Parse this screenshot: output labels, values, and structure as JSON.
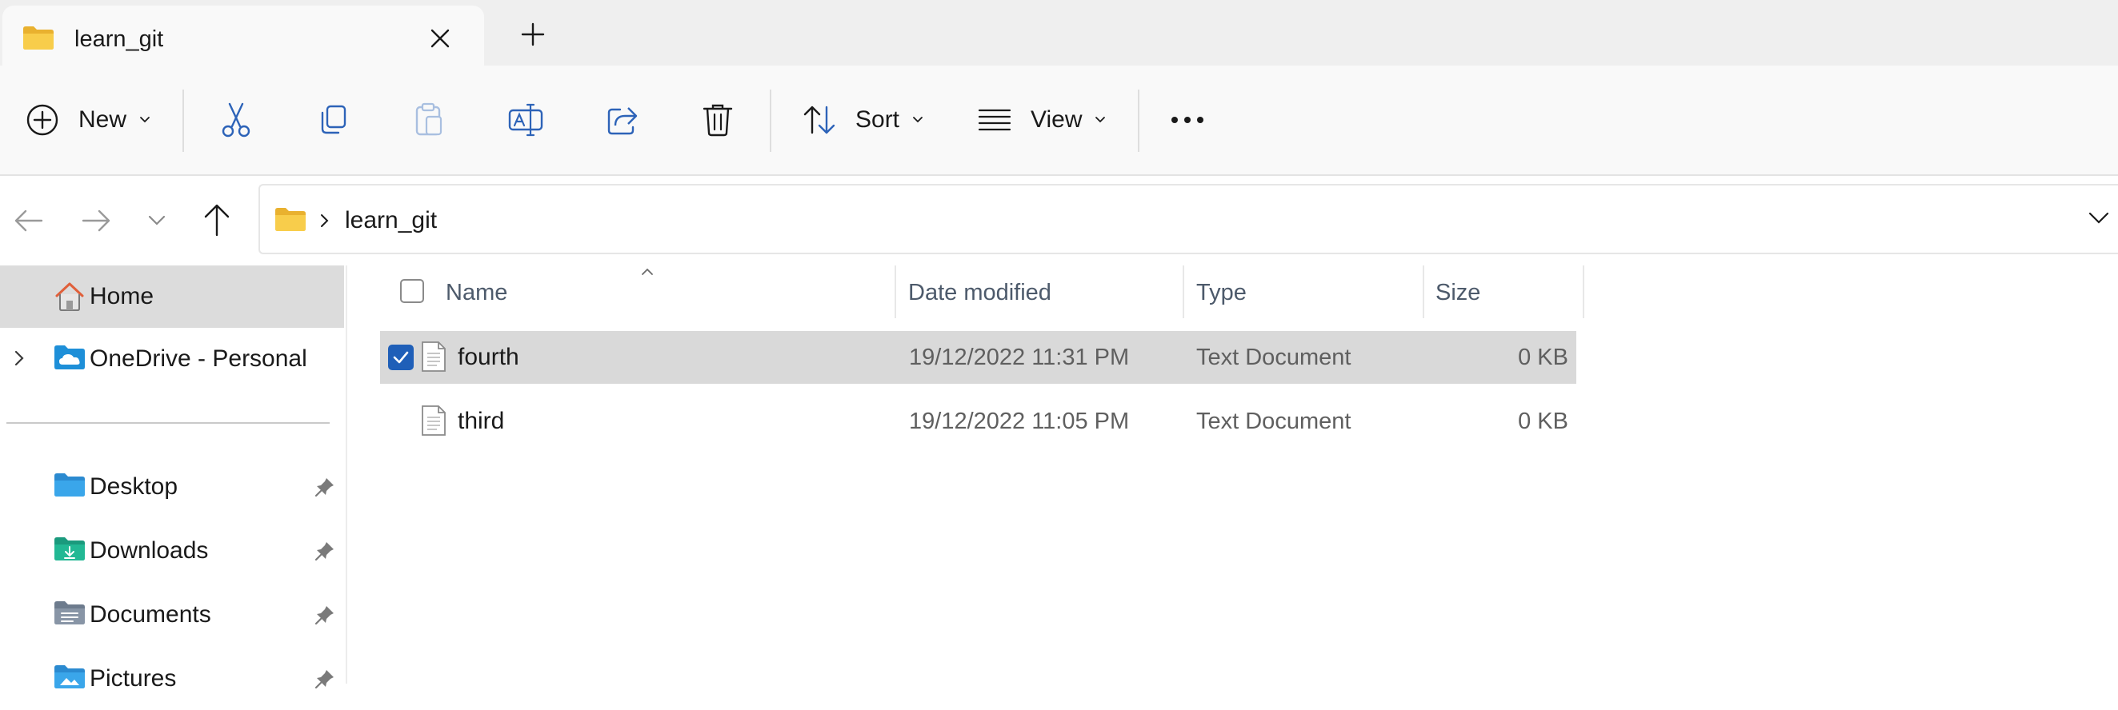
{
  "window": {
    "tab_title": "learn_git",
    "icons": {
      "tab": "folder-icon",
      "close": "close-icon",
      "new_tab": "plus-icon"
    }
  },
  "command_bar": {
    "new_label": "New",
    "sort_label": "Sort",
    "view_label": "View",
    "icons": [
      "add-circle-icon",
      "cut-icon",
      "copy-icon",
      "paste-icon",
      "rename-icon",
      "share-icon",
      "delete-icon",
      "sort-icon",
      "view-icon",
      "more-icon"
    ]
  },
  "address_bar": {
    "breadcrumb": "learn_git",
    "icons": [
      "back-icon",
      "forward-icon",
      "recent-chevron-icon",
      "up-icon",
      "folder-icon",
      "breadcrumb-chevron-icon",
      "history-dropdown-icon"
    ]
  },
  "sidebar": {
    "items": [
      {
        "label": "Home",
        "icon": "home-icon",
        "selected": true
      },
      {
        "label": "OneDrive - Personal",
        "icon": "onedrive-icon",
        "expandable": true
      },
      {
        "label": "Desktop",
        "icon": "desktop-icon",
        "pinned": true
      },
      {
        "label": "Downloads",
        "icon": "downloads-icon",
        "pinned": true
      },
      {
        "label": "Documents",
        "icon": "documents-icon",
        "pinned": true
      },
      {
        "label": "Pictures",
        "icon": "pictures-icon",
        "pinned": true
      }
    ]
  },
  "file_list": {
    "columns": [
      "Name",
      "Date modified",
      "Type",
      "Size"
    ],
    "sorted_by": "Name",
    "rows": [
      {
        "name": "fourth",
        "date": "19/12/2022 11:31 PM",
        "type": "Text Document",
        "size": "0 KB",
        "selected": true
      },
      {
        "name": "third",
        "date": "19/12/2022 11:05 PM",
        "type": "Text Document",
        "size": "0 KB",
        "selected": false
      }
    ]
  },
  "colors": {
    "accent": "#1f5fb8",
    "folder_yellow": "#f3c23e",
    "selection": "#d9d9d9",
    "sidebar_selected": "#dcdcdc"
  }
}
